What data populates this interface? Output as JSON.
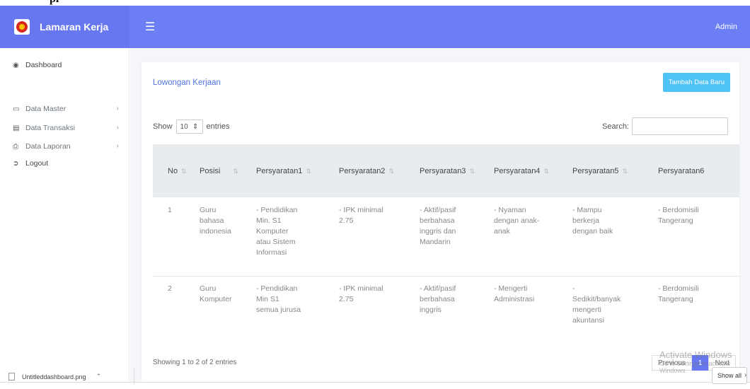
{
  "brand": {
    "name": "Lamaran Kerja"
  },
  "navbar": {
    "menu_icon": "hamburger-icon",
    "user": "Admin"
  },
  "sidebar": {
    "items": [
      {
        "label": "Dashboard",
        "icon": "dashboard-icon"
      },
      {
        "label": "Data Master",
        "icon": "monitor-icon"
      },
      {
        "label": "Data Transaksi",
        "icon": "database-icon"
      },
      {
        "label": "Data Laporan",
        "icon": "printer-icon"
      },
      {
        "label": "Logout",
        "icon": "logout-icon"
      }
    ]
  },
  "card": {
    "title": "Lowongan Kerjaan",
    "add_button": "Tambah Data Baru"
  },
  "table_controls": {
    "show_label": "Show",
    "entries_value": "10",
    "entries_label": "entries",
    "search_label": "Search:"
  },
  "table": {
    "columns": [
      "No",
      "Posisi",
      "Persyaratan1",
      "Persyaratan2",
      "Persyaratan3",
      "Persyaratan4",
      "Persyaratan5",
      "Persyaratan6"
    ],
    "rows": [
      [
        "1",
        "Guru\nbahasa\nindonesia",
        "- Pendidikan\nMin. S1\nKomputer\natau Sistem\nInformasi",
        "- IPK minimal\n2.75",
        "- Aktif/pasif\nberbahasa\ninggris dan\nMandarin",
        "- Nyaman\ndengan anak-\nanak",
        "- Mampu\nberkerja\ndengan baik",
        "- Berdomisili\nTangerang"
      ],
      [
        "2",
        "Guru\nKomputer",
        "- Pendidikan\nMin S1\nsemua jurusa",
        "- IPK minimal\n2.75",
        "- Aktif/pasif\nberbahasa\ninggris",
        "- Mengerti\nAdministrasi",
        "-\nSedikit/banyak\nmengerti\nakuntansi",
        "- Berdomisili\nTangerang"
      ]
    ]
  },
  "footer": {
    "info": "Showing 1 to 2 of 2 entries",
    "previous": "Previous",
    "current_page": "1",
    "next": "Next"
  },
  "watermark": {
    "line1": "Activate Windows",
    "line2": "Go to Settings to activate Windows."
  },
  "download_bar": {
    "file_name": "Untitleddashboard.png",
    "show_all": "Show all"
  },
  "colors": {
    "primary": "#6777ef",
    "info_button": "#4fc3f7",
    "link": "#4e73df"
  }
}
